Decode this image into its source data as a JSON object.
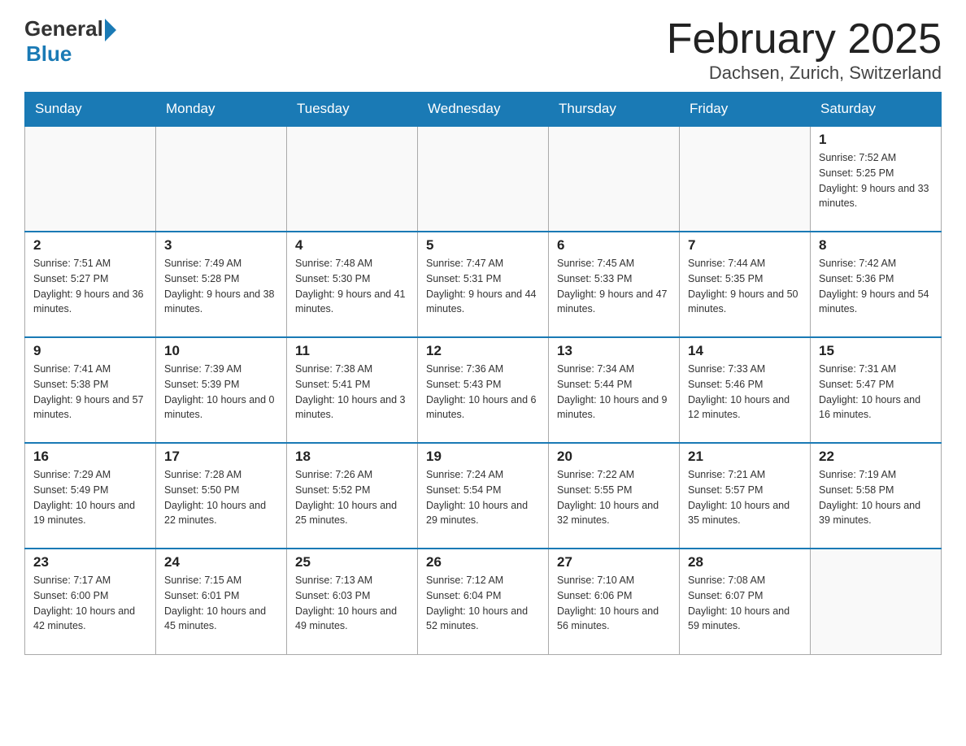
{
  "header": {
    "logo_general": "General",
    "logo_blue": "Blue",
    "month_title": "February 2025",
    "location": "Dachsen, Zurich, Switzerland"
  },
  "days_of_week": [
    "Sunday",
    "Monday",
    "Tuesday",
    "Wednesday",
    "Thursday",
    "Friday",
    "Saturday"
  ],
  "weeks": [
    [
      {
        "day": "",
        "info": ""
      },
      {
        "day": "",
        "info": ""
      },
      {
        "day": "",
        "info": ""
      },
      {
        "day": "",
        "info": ""
      },
      {
        "day": "",
        "info": ""
      },
      {
        "day": "",
        "info": ""
      },
      {
        "day": "1",
        "info": "Sunrise: 7:52 AM\nSunset: 5:25 PM\nDaylight: 9 hours and 33 minutes."
      }
    ],
    [
      {
        "day": "2",
        "info": "Sunrise: 7:51 AM\nSunset: 5:27 PM\nDaylight: 9 hours and 36 minutes."
      },
      {
        "day": "3",
        "info": "Sunrise: 7:49 AM\nSunset: 5:28 PM\nDaylight: 9 hours and 38 minutes."
      },
      {
        "day": "4",
        "info": "Sunrise: 7:48 AM\nSunset: 5:30 PM\nDaylight: 9 hours and 41 minutes."
      },
      {
        "day": "5",
        "info": "Sunrise: 7:47 AM\nSunset: 5:31 PM\nDaylight: 9 hours and 44 minutes."
      },
      {
        "day": "6",
        "info": "Sunrise: 7:45 AM\nSunset: 5:33 PM\nDaylight: 9 hours and 47 minutes."
      },
      {
        "day": "7",
        "info": "Sunrise: 7:44 AM\nSunset: 5:35 PM\nDaylight: 9 hours and 50 minutes."
      },
      {
        "day": "8",
        "info": "Sunrise: 7:42 AM\nSunset: 5:36 PM\nDaylight: 9 hours and 54 minutes."
      }
    ],
    [
      {
        "day": "9",
        "info": "Sunrise: 7:41 AM\nSunset: 5:38 PM\nDaylight: 9 hours and 57 minutes."
      },
      {
        "day": "10",
        "info": "Sunrise: 7:39 AM\nSunset: 5:39 PM\nDaylight: 10 hours and 0 minutes."
      },
      {
        "day": "11",
        "info": "Sunrise: 7:38 AM\nSunset: 5:41 PM\nDaylight: 10 hours and 3 minutes."
      },
      {
        "day": "12",
        "info": "Sunrise: 7:36 AM\nSunset: 5:43 PM\nDaylight: 10 hours and 6 minutes."
      },
      {
        "day": "13",
        "info": "Sunrise: 7:34 AM\nSunset: 5:44 PM\nDaylight: 10 hours and 9 minutes."
      },
      {
        "day": "14",
        "info": "Sunrise: 7:33 AM\nSunset: 5:46 PM\nDaylight: 10 hours and 12 minutes."
      },
      {
        "day": "15",
        "info": "Sunrise: 7:31 AM\nSunset: 5:47 PM\nDaylight: 10 hours and 16 minutes."
      }
    ],
    [
      {
        "day": "16",
        "info": "Sunrise: 7:29 AM\nSunset: 5:49 PM\nDaylight: 10 hours and 19 minutes."
      },
      {
        "day": "17",
        "info": "Sunrise: 7:28 AM\nSunset: 5:50 PM\nDaylight: 10 hours and 22 minutes."
      },
      {
        "day": "18",
        "info": "Sunrise: 7:26 AM\nSunset: 5:52 PM\nDaylight: 10 hours and 25 minutes."
      },
      {
        "day": "19",
        "info": "Sunrise: 7:24 AM\nSunset: 5:54 PM\nDaylight: 10 hours and 29 minutes."
      },
      {
        "day": "20",
        "info": "Sunrise: 7:22 AM\nSunset: 5:55 PM\nDaylight: 10 hours and 32 minutes."
      },
      {
        "day": "21",
        "info": "Sunrise: 7:21 AM\nSunset: 5:57 PM\nDaylight: 10 hours and 35 minutes."
      },
      {
        "day": "22",
        "info": "Sunrise: 7:19 AM\nSunset: 5:58 PM\nDaylight: 10 hours and 39 minutes."
      }
    ],
    [
      {
        "day": "23",
        "info": "Sunrise: 7:17 AM\nSunset: 6:00 PM\nDaylight: 10 hours and 42 minutes."
      },
      {
        "day": "24",
        "info": "Sunrise: 7:15 AM\nSunset: 6:01 PM\nDaylight: 10 hours and 45 minutes."
      },
      {
        "day": "25",
        "info": "Sunrise: 7:13 AM\nSunset: 6:03 PM\nDaylight: 10 hours and 49 minutes."
      },
      {
        "day": "26",
        "info": "Sunrise: 7:12 AM\nSunset: 6:04 PM\nDaylight: 10 hours and 52 minutes."
      },
      {
        "day": "27",
        "info": "Sunrise: 7:10 AM\nSunset: 6:06 PM\nDaylight: 10 hours and 56 minutes."
      },
      {
        "day": "28",
        "info": "Sunrise: 7:08 AM\nSunset: 6:07 PM\nDaylight: 10 hours and 59 minutes."
      },
      {
        "day": "",
        "info": ""
      }
    ]
  ]
}
